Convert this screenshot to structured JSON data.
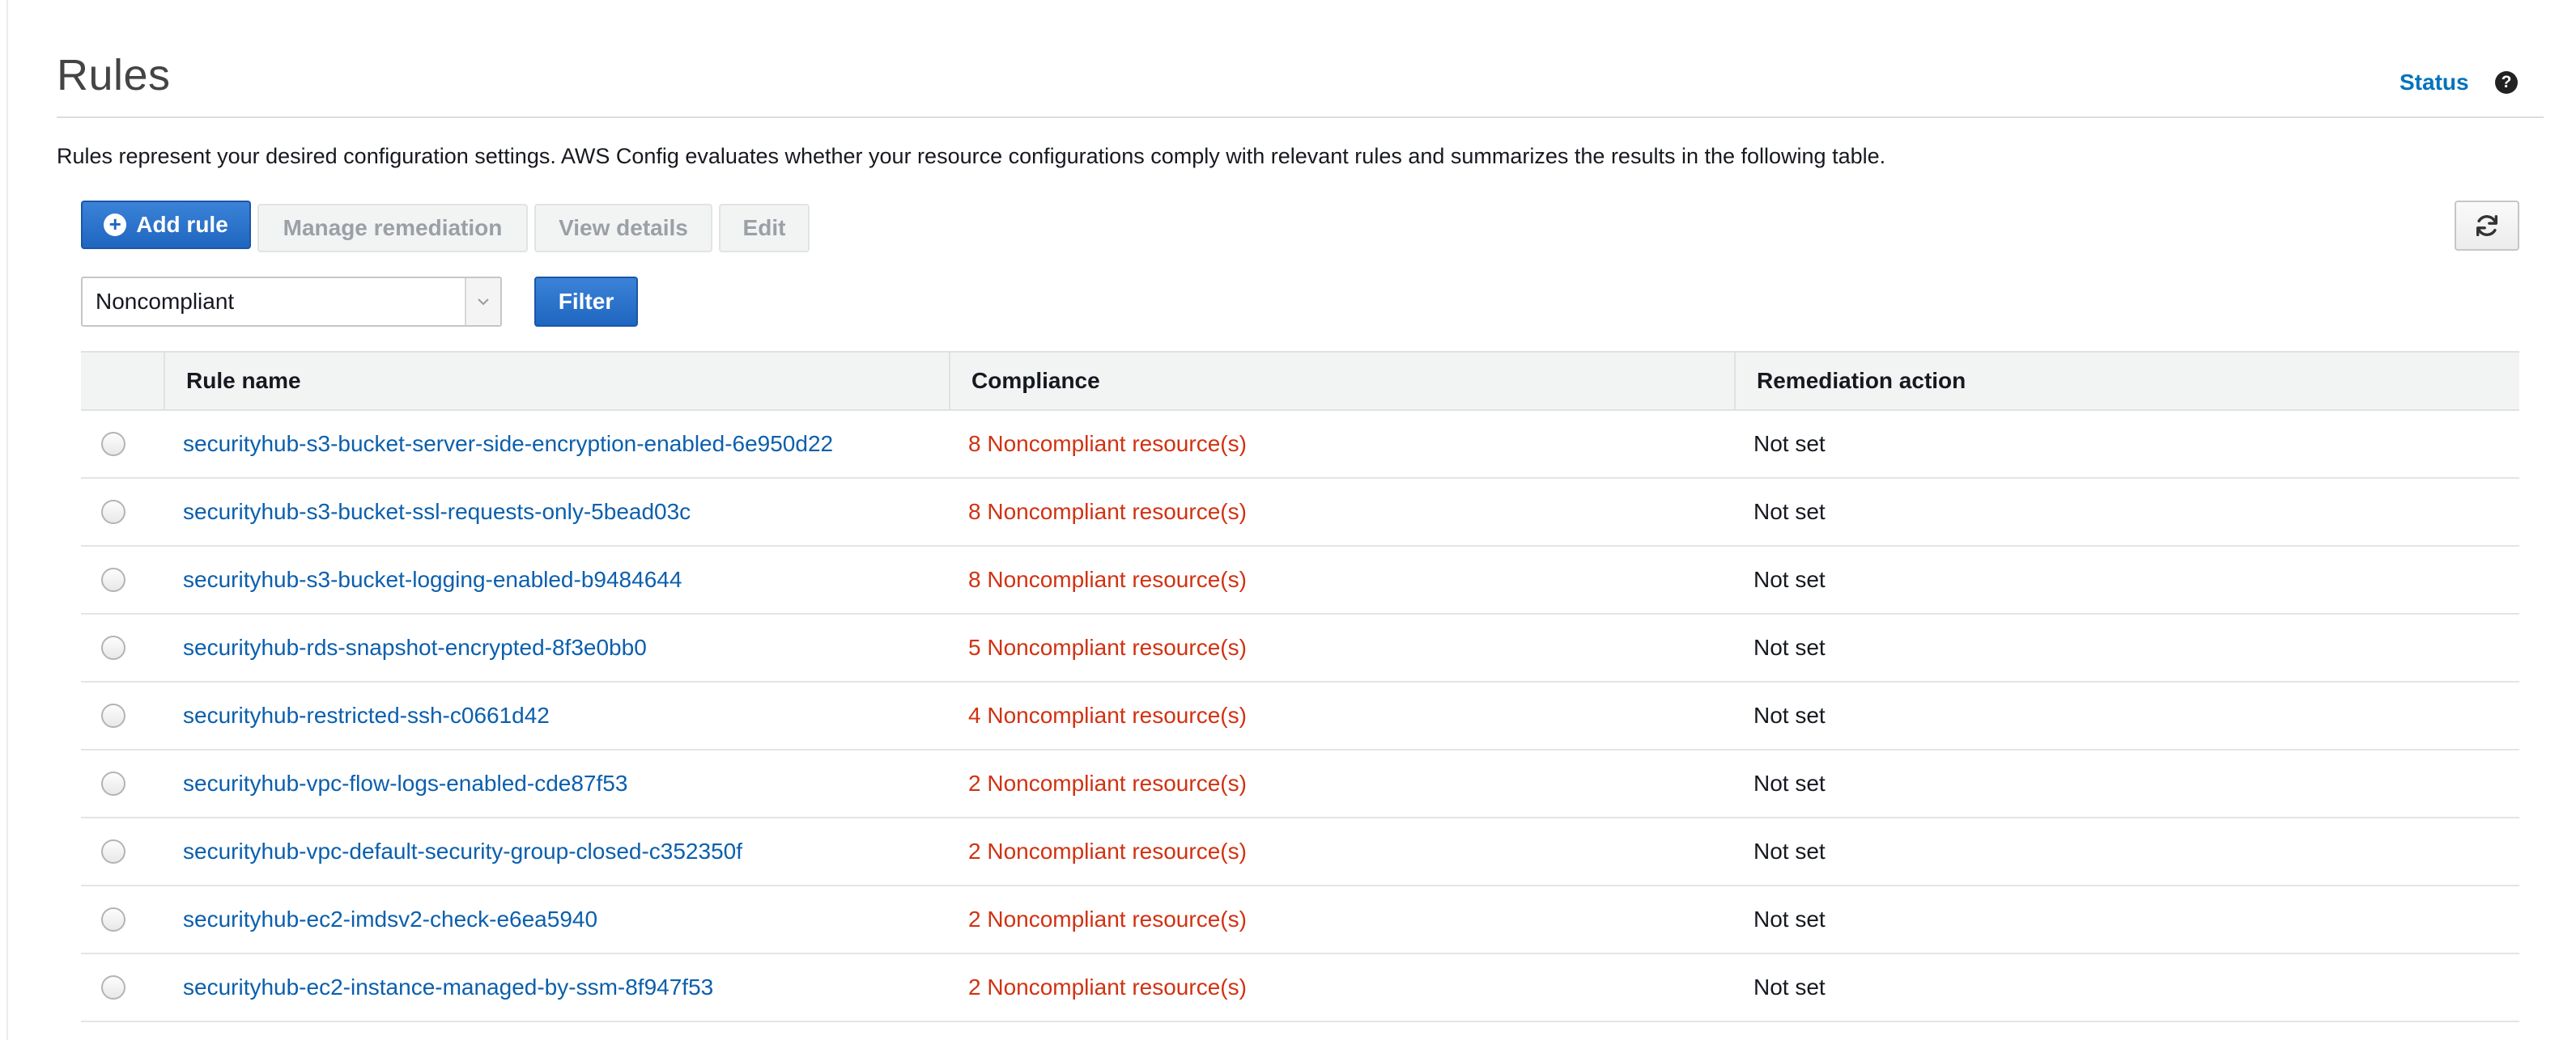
{
  "header": {
    "title": "Rules",
    "status_link": "Status",
    "help_icon": "?"
  },
  "description": "Rules represent your desired configuration settings. AWS Config evaluates whether your resource configurations comply with relevant rules and summarizes the results in the following table.",
  "toolbar": {
    "add_rule_label": "Add rule",
    "add_icon": "+",
    "manage_remediation_label": "Manage remediation",
    "view_details_label": "View details",
    "edit_label": "Edit"
  },
  "filter": {
    "selected": "Noncompliant",
    "button_label": "Filter"
  },
  "table": {
    "columns": [
      "Rule name",
      "Compliance",
      "Remediation action"
    ],
    "rows": [
      {
        "name": "securityhub-s3-bucket-server-side-encryption-enabled-6e950d22",
        "compliance": "8 Noncompliant resource(s)",
        "remediation": "Not set"
      },
      {
        "name": "securityhub-s3-bucket-ssl-requests-only-5bead03c",
        "compliance": "8 Noncompliant resource(s)",
        "remediation": "Not set"
      },
      {
        "name": "securityhub-s3-bucket-logging-enabled-b9484644",
        "compliance": "8 Noncompliant resource(s)",
        "remediation": "Not set"
      },
      {
        "name": "securityhub-rds-snapshot-encrypted-8f3e0bb0",
        "compliance": "5 Noncompliant resource(s)",
        "remediation": "Not set"
      },
      {
        "name": "securityhub-restricted-ssh-c0661d42",
        "compliance": "4 Noncompliant resource(s)",
        "remediation": "Not set"
      },
      {
        "name": "securityhub-vpc-flow-logs-enabled-cde87f53",
        "compliance": "2 Noncompliant resource(s)",
        "remediation": "Not set"
      },
      {
        "name": "securityhub-vpc-default-security-group-closed-c352350f",
        "compliance": "2 Noncompliant resource(s)",
        "remediation": "Not set"
      },
      {
        "name": "securityhub-ec2-imdsv2-check-e6ea5940",
        "compliance": "2 Noncompliant resource(s)",
        "remediation": "Not set"
      },
      {
        "name": "securityhub-ec2-instance-managed-by-ssm-8f947f53",
        "compliance": "2 Noncompliant resource(s)",
        "remediation": "Not set"
      }
    ]
  },
  "colors": {
    "link": "#0b5fad",
    "noncompliant": "#d13212",
    "primary_button": "#1f66c0"
  }
}
